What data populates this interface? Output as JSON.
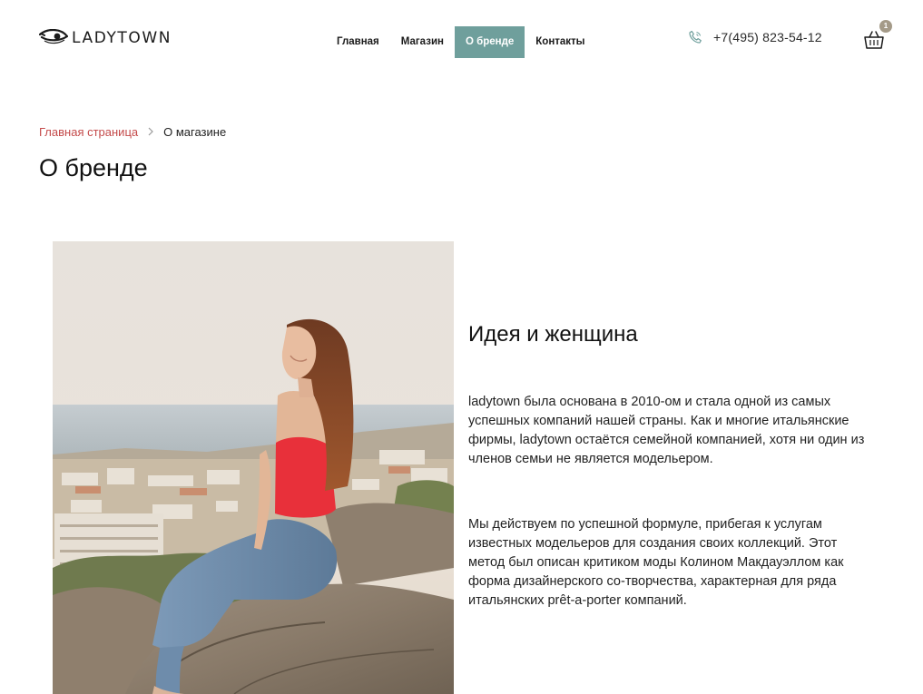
{
  "header": {
    "logo_text": "LADYTOWN",
    "nav": [
      {
        "label": "Главная",
        "active": false
      },
      {
        "label": "Магазин",
        "active": false
      },
      {
        "label": "О бренде",
        "active": true
      },
      {
        "label": "Контакты",
        "active": false
      }
    ],
    "phone": "+7(495) 823-54-12",
    "cart_count": "1",
    "icons": {
      "logo": "eye-icon",
      "phone": "phone-icon",
      "cart": "basket-icon",
      "separator": "chevron-right-icon"
    }
  },
  "breadcrumb": {
    "home": "Главная страница",
    "current": "О магазине"
  },
  "page_title": "О бренде",
  "content": {
    "photo": "woman-sitting-on-rock-over-coastal-town-photo",
    "section_title": "Идея и женщина",
    "paragraphs": [
      "ladytown была основана в 2010-ом и стала одной из самых успешных компаний нашей страны. Как и многие итальянские фирмы, ladytown остаётся семейной компанией, хотя ни один из членов семьи не является модельером.",
      "Мы действуем по успешной формуле, прибегая к услугам известных модельеров для создания своих коллекций. Этот метод был описан критиком моды Колином Макдауэллом как форма дизайнерского со-творчества, характерная для ряда итальянских prêt-a-porter компаний."
    ]
  },
  "colors": {
    "accent": "#6f9f9c",
    "breadcrumb_link": "#c44a4a",
    "badge": "#a49a88",
    "top_red": "#e8303a"
  }
}
